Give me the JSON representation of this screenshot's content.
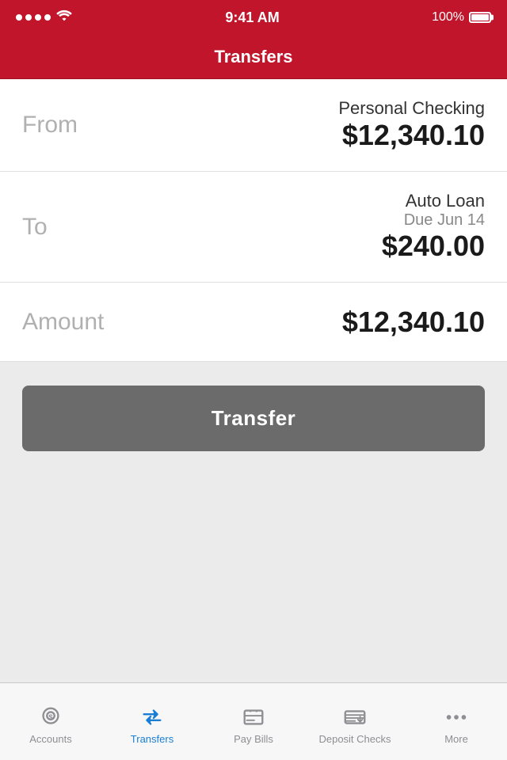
{
  "statusBar": {
    "time": "9:41 AM",
    "battery": "100%"
  },
  "header": {
    "title": "Transfers"
  },
  "form": {
    "fromLabel": "From",
    "fromAccountName": "Personal Checking",
    "fromAmount": "$12,340.10",
    "toLabel": "To",
    "toAccountName": "Auto Loan",
    "toDueDate": "Due Jun 14",
    "toAmount": "$240.00",
    "amountLabel": "Amount",
    "amountValue": "$12,340.10"
  },
  "transferButton": {
    "label": "Transfer"
  },
  "tabBar": {
    "items": [
      {
        "id": "accounts",
        "label": "Accounts",
        "active": false
      },
      {
        "id": "transfers",
        "label": "Transfers",
        "active": true
      },
      {
        "id": "pay-bills",
        "label": "Pay Bills",
        "active": false
      },
      {
        "id": "deposit-checks",
        "label": "Deposit Checks",
        "active": false
      },
      {
        "id": "more",
        "label": "More",
        "active": false
      }
    ]
  }
}
